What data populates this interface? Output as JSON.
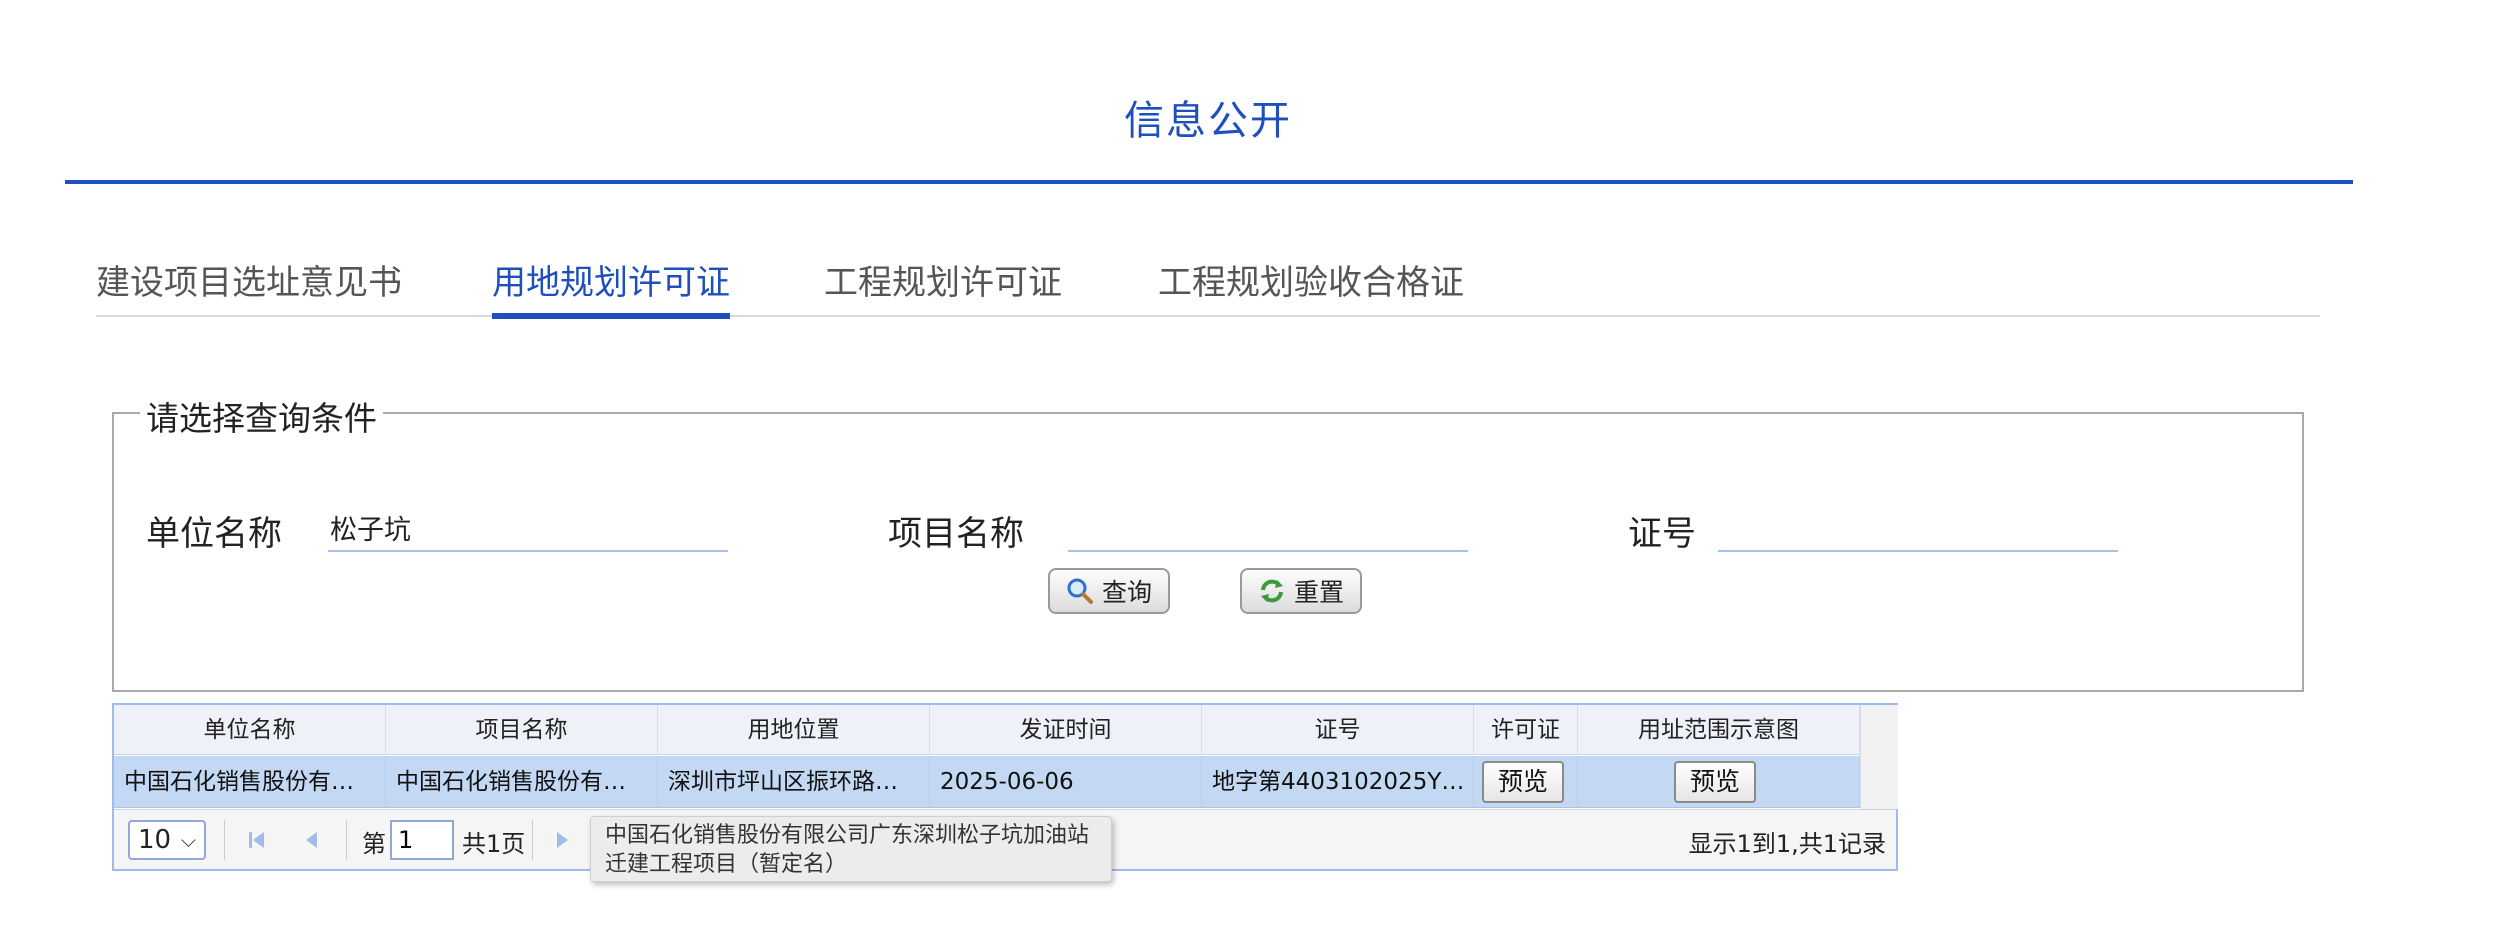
{
  "page": {
    "title": "信息公开"
  },
  "tabs": [
    {
      "label": "建设项目选址意见书",
      "active": false
    },
    {
      "label": "用地规划许可证",
      "active": true
    },
    {
      "label": "工程规划许可证",
      "active": false
    },
    {
      "label": "工程规划验收合格证",
      "active": false
    }
  ],
  "query": {
    "legend": "请选择查询条件",
    "unit_label": "单位名称",
    "unit_value": "松子坑",
    "project_label": "项目名称",
    "project_value": "",
    "cert_label": "证号",
    "cert_value": "",
    "search_label": "查询",
    "reset_label": "重置"
  },
  "table": {
    "headers": [
      "单位名称",
      "项目名称",
      "用地位置",
      "发证时间",
      "证号",
      "许可证",
      "用址范围示意图"
    ],
    "rows": [
      {
        "unit": "中国石化销售股份有…",
        "project": "中国石化销售股份有…",
        "location": "深圳市坪山区振环路…",
        "date": "2025-06-06",
        "cert_no": "地字第4403102025Y…",
        "permit_btn": "预览",
        "map_btn": "预览"
      }
    ]
  },
  "pager": {
    "page_size": "10",
    "page_prefix": "第",
    "page_value": "1",
    "page_total": "共1页",
    "summary": "显示1到1,共1记录"
  },
  "tooltip": {
    "line1": "中国石化销售股份有限公司广东深圳松子坑加油站",
    "line2": "迁建工程项目（暂定名）"
  },
  "colors": {
    "accent": "#1f4fbf",
    "row_selected": "#c3d8f3",
    "grid_border": "#9ebcea"
  },
  "icons": {
    "search": "magnifier-icon",
    "reset": "refresh-icon",
    "first": "first-page-icon",
    "prev": "prev-page-icon",
    "next": "next-page-icon"
  }
}
